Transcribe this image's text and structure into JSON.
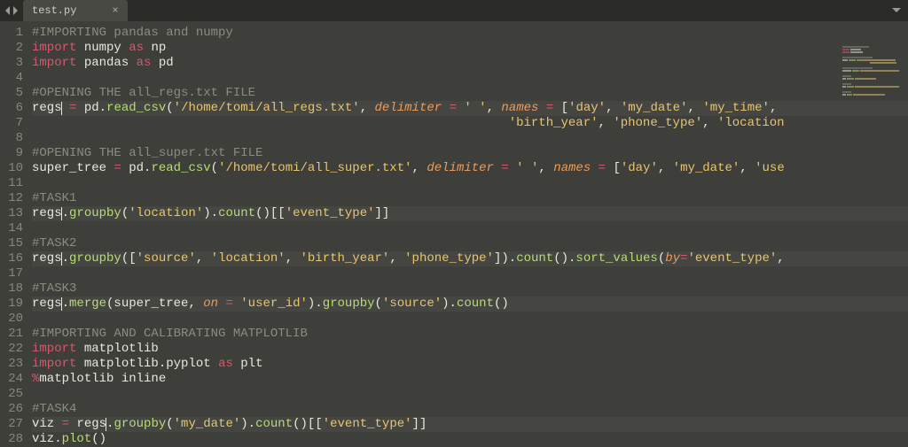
{
  "tab": {
    "filename": "test.py",
    "close": "×"
  },
  "lines": [
    {
      "n": 1,
      "hl": false,
      "tokens": [
        [
          "c-comment",
          "#IMPORTING pandas and numpy"
        ]
      ]
    },
    {
      "n": 2,
      "hl": false,
      "tokens": [
        [
          "c-kw",
          "import"
        ],
        [
          "c-ident",
          " numpy "
        ],
        [
          "c-kw",
          "as"
        ],
        [
          "c-ident",
          " np"
        ]
      ]
    },
    {
      "n": 3,
      "hl": false,
      "tokens": [
        [
          "c-kw",
          "import"
        ],
        [
          "c-ident",
          " pandas "
        ],
        [
          "c-kw",
          "as"
        ],
        [
          "c-ident",
          " pd"
        ]
      ]
    },
    {
      "n": 4,
      "hl": false,
      "tokens": []
    },
    {
      "n": 5,
      "hl": false,
      "tokens": [
        [
          "c-comment",
          "#OPENING THE all_regs.txt FILE"
        ]
      ]
    },
    {
      "n": 6,
      "hl": true,
      "tokens": [
        [
          "c-ident",
          "regs"
        ],
        [
          "cursor",
          ""
        ],
        [
          "c-ident",
          " "
        ],
        [
          "c-op",
          "="
        ],
        [
          "c-ident",
          " pd"
        ],
        [
          "c-punct",
          "."
        ],
        [
          "c-func",
          "read_csv"
        ],
        [
          "c-punct",
          "("
        ],
        [
          "c-str",
          "'/home/tomi/all_regs.txt'"
        ],
        [
          "c-punct",
          ", "
        ],
        [
          "c-param",
          "delimiter"
        ],
        [
          "c-ident",
          " "
        ],
        [
          "c-op",
          "="
        ],
        [
          "c-ident",
          " "
        ],
        [
          "c-str",
          "' '"
        ],
        [
          "c-punct",
          ", "
        ],
        [
          "c-param",
          "names"
        ],
        [
          "c-ident",
          " "
        ],
        [
          "c-op",
          "="
        ],
        [
          "c-ident",
          " "
        ],
        [
          "c-punct",
          "["
        ],
        [
          "c-str",
          "'day'"
        ],
        [
          "c-punct",
          ", "
        ],
        [
          "c-str",
          "'my_date'"
        ],
        [
          "c-punct",
          ", "
        ],
        [
          "c-str",
          "'my_time'"
        ],
        [
          "c-punct",
          ","
        ]
      ]
    },
    {
      "n": 7,
      "hl": false,
      "tokens": [
        [
          "c-ident",
          "                                                                "
        ],
        [
          "c-str",
          "'birth_year'"
        ],
        [
          "c-punct",
          ", "
        ],
        [
          "c-str",
          "'phone_type'"
        ],
        [
          "c-punct",
          ", "
        ],
        [
          "c-str",
          "'location"
        ]
      ]
    },
    {
      "n": 8,
      "hl": false,
      "tokens": []
    },
    {
      "n": 9,
      "hl": false,
      "tokens": [
        [
          "c-comment",
          "#OPENING THE all_super.txt FILE"
        ]
      ]
    },
    {
      "n": 10,
      "hl": false,
      "tokens": [
        [
          "c-ident",
          "super_tree "
        ],
        [
          "c-op",
          "="
        ],
        [
          "c-ident",
          " pd"
        ],
        [
          "c-punct",
          "."
        ],
        [
          "c-func",
          "read_csv"
        ],
        [
          "c-punct",
          "("
        ],
        [
          "c-str",
          "'/home/tomi/all_super.txt'"
        ],
        [
          "c-punct",
          ", "
        ],
        [
          "c-param",
          "delimiter"
        ],
        [
          "c-ident",
          " "
        ],
        [
          "c-op",
          "="
        ],
        [
          "c-ident",
          " "
        ],
        [
          "c-str",
          "' '"
        ],
        [
          "c-punct",
          ", "
        ],
        [
          "c-param",
          "names"
        ],
        [
          "c-ident",
          " "
        ],
        [
          "c-op",
          "="
        ],
        [
          "c-ident",
          " "
        ],
        [
          "c-punct",
          "["
        ],
        [
          "c-str",
          "'day'"
        ],
        [
          "c-punct",
          ", "
        ],
        [
          "c-str",
          "'my_date'"
        ],
        [
          "c-punct",
          ", "
        ],
        [
          "c-str",
          "'use"
        ]
      ]
    },
    {
      "n": 11,
      "hl": false,
      "tokens": []
    },
    {
      "n": 12,
      "hl": false,
      "tokens": [
        [
          "c-comment",
          "#TASK1"
        ]
      ]
    },
    {
      "n": 13,
      "hl": true,
      "tokens": [
        [
          "c-ident",
          "regs"
        ],
        [
          "cursor",
          ""
        ],
        [
          "c-punct",
          "."
        ],
        [
          "c-func",
          "groupby"
        ],
        [
          "c-punct",
          "("
        ],
        [
          "c-str",
          "'location'"
        ],
        [
          "c-punct",
          ")."
        ],
        [
          "c-func",
          "count"
        ],
        [
          "c-punct",
          "()[["
        ],
        [
          "c-str",
          "'event_type'"
        ],
        [
          "c-punct",
          "]]"
        ]
      ]
    },
    {
      "n": 14,
      "hl": false,
      "tokens": []
    },
    {
      "n": 15,
      "hl": false,
      "tokens": [
        [
          "c-comment",
          "#TASK2"
        ]
      ]
    },
    {
      "n": 16,
      "hl": true,
      "tokens": [
        [
          "c-ident",
          "regs"
        ],
        [
          "cursor",
          ""
        ],
        [
          "c-punct",
          "."
        ],
        [
          "c-func",
          "groupby"
        ],
        [
          "c-punct",
          "(["
        ],
        [
          "c-str",
          "'source'"
        ],
        [
          "c-punct",
          ", "
        ],
        [
          "c-str",
          "'location'"
        ],
        [
          "c-punct",
          ", "
        ],
        [
          "c-str",
          "'birth_year'"
        ],
        [
          "c-punct",
          ", "
        ],
        [
          "c-str",
          "'phone_type'"
        ],
        [
          "c-punct",
          "])."
        ],
        [
          "c-func",
          "count"
        ],
        [
          "c-punct",
          "()."
        ],
        [
          "c-func",
          "sort_values"
        ],
        [
          "c-punct",
          "("
        ],
        [
          "c-param",
          "by"
        ],
        [
          "c-op",
          "="
        ],
        [
          "c-str",
          "'event_type'"
        ],
        [
          "c-punct",
          ","
        ]
      ]
    },
    {
      "n": 17,
      "hl": false,
      "tokens": []
    },
    {
      "n": 18,
      "hl": false,
      "tokens": [
        [
          "c-comment",
          "#TASK3"
        ]
      ]
    },
    {
      "n": 19,
      "hl": true,
      "tokens": [
        [
          "c-ident",
          "regs"
        ],
        [
          "cursor",
          ""
        ],
        [
          "c-punct",
          "."
        ],
        [
          "c-func",
          "merge"
        ],
        [
          "c-punct",
          "(super_tree, "
        ],
        [
          "c-param",
          "on"
        ],
        [
          "c-ident",
          " "
        ],
        [
          "c-op",
          "="
        ],
        [
          "c-ident",
          " "
        ],
        [
          "c-str",
          "'user_id'"
        ],
        [
          "c-punct",
          ")."
        ],
        [
          "c-func",
          "groupby"
        ],
        [
          "c-punct",
          "("
        ],
        [
          "c-str",
          "'source'"
        ],
        [
          "c-punct",
          ")."
        ],
        [
          "c-func",
          "count"
        ],
        [
          "c-punct",
          "()"
        ]
      ]
    },
    {
      "n": 20,
      "hl": false,
      "tokens": []
    },
    {
      "n": 21,
      "hl": false,
      "tokens": [
        [
          "c-comment",
          "#IMPORTING AND CALIBRATING MATPLOTLIB"
        ]
      ]
    },
    {
      "n": 22,
      "hl": false,
      "tokens": [
        [
          "c-kw",
          "import"
        ],
        [
          "c-ident",
          " matplotlib"
        ]
      ]
    },
    {
      "n": 23,
      "hl": false,
      "tokens": [
        [
          "c-kw",
          "import"
        ],
        [
          "c-ident",
          " matplotlib"
        ],
        [
          "c-punct",
          "."
        ],
        [
          "c-ident",
          "pyplot "
        ],
        [
          "c-kw",
          "as"
        ],
        [
          "c-ident",
          " plt"
        ]
      ]
    },
    {
      "n": 24,
      "hl": false,
      "tokens": [
        [
          "c-dec",
          "%"
        ],
        [
          "c-ident",
          "matplotlib inline"
        ]
      ]
    },
    {
      "n": 25,
      "hl": false,
      "tokens": []
    },
    {
      "n": 26,
      "hl": false,
      "tokens": [
        [
          "c-comment",
          "#TASK4"
        ]
      ]
    },
    {
      "n": 27,
      "hl": true,
      "tokens": [
        [
          "c-ident",
          "viz "
        ],
        [
          "c-op",
          "="
        ],
        [
          "c-ident",
          " regs"
        ],
        [
          "cursor",
          ""
        ],
        [
          "c-punct",
          "."
        ],
        [
          "c-func",
          "groupby"
        ],
        [
          "c-punct",
          "("
        ],
        [
          "c-str",
          "'my_date'"
        ],
        [
          "c-punct",
          ")."
        ],
        [
          "c-func",
          "count"
        ],
        [
          "c-punct",
          "()[["
        ],
        [
          "c-str",
          "'event_type'"
        ],
        [
          "c-punct",
          "]]"
        ]
      ]
    },
    {
      "n": 28,
      "hl": false,
      "tokens": [
        [
          "c-ident",
          "viz"
        ],
        [
          "c-punct",
          "."
        ],
        [
          "c-func",
          "plot"
        ],
        [
          "c-punct",
          "()"
        ]
      ]
    }
  ]
}
